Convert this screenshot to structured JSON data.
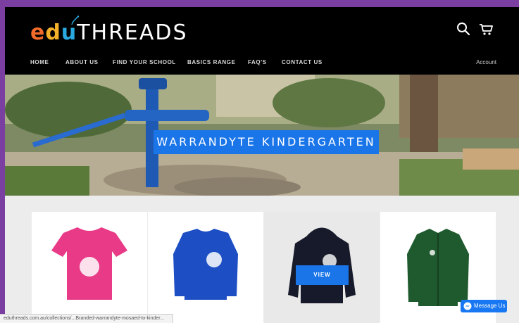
{
  "brand": {
    "logo_letters": [
      "e",
      "d",
      "u"
    ],
    "logo_suffix": "THREADS",
    "colors": {
      "e": "#f26b2a",
      "d": "#f4b02a",
      "u": "#2aa8e0",
      "accent": "#1a75e8"
    }
  },
  "header": {
    "icons": [
      "search-icon",
      "cart-icon"
    ]
  },
  "nav": {
    "items": [
      "HOME",
      "ABOUT US",
      "FIND YOUR SCHOOL",
      "BASICS RANGE",
      "FAQ'S",
      "CONTACT US"
    ],
    "account_label": "Account"
  },
  "hero": {
    "title": "WARRANDYTE KINDERGARTEN"
  },
  "products": {
    "items": [
      {
        "name": "pink t-shirt",
        "color": "#e83a86"
      },
      {
        "name": "royal blue jumper",
        "color": "#1d4ec4"
      },
      {
        "name": "black hoodie",
        "color": "#161a2a"
      },
      {
        "name": "green zip jacket",
        "color": "#1f5a2e"
      }
    ],
    "view_label": "VIEW"
  },
  "status_bar": {
    "url": "eduthreads.com.au/collections/...Branded-warrandyte-mosaed-to-kinder..."
  },
  "messenger": {
    "label": "Message Us"
  }
}
